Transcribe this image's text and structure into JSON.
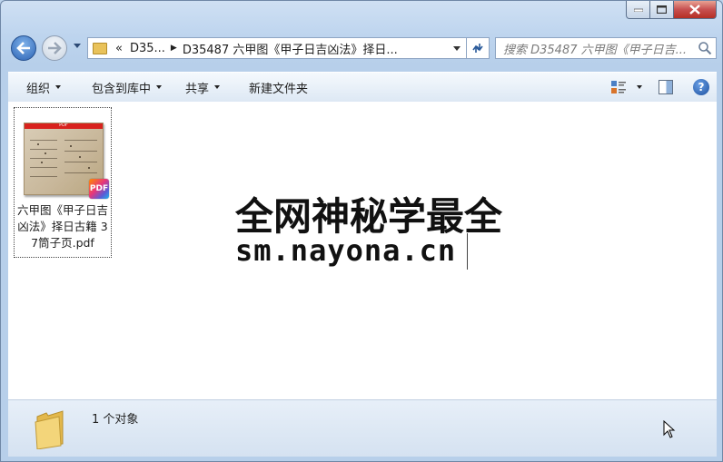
{
  "address": {
    "overflow": "«",
    "parts": [
      "D35...",
      "D35487 六甲图《甲子日吉凶法》择日..."
    ]
  },
  "search": {
    "placeholder": "搜索 D35487 六甲图《甲子日吉..."
  },
  "toolbar": {
    "organize": "组织",
    "include_in_library": "包含到库中",
    "share": "共享",
    "new_folder": "新建文件夹",
    "help": "?"
  },
  "files": [
    {
      "name": "六甲图《甲子日吉凶法》择日古籍 37筒子页.pdf",
      "thumb_label": "PDF",
      "badge": "PDF"
    }
  ],
  "watermark": {
    "line1": "全网神秘学最全",
    "line2": "sm.nayona.cn"
  },
  "status": {
    "count_text": "1 个对象"
  }
}
